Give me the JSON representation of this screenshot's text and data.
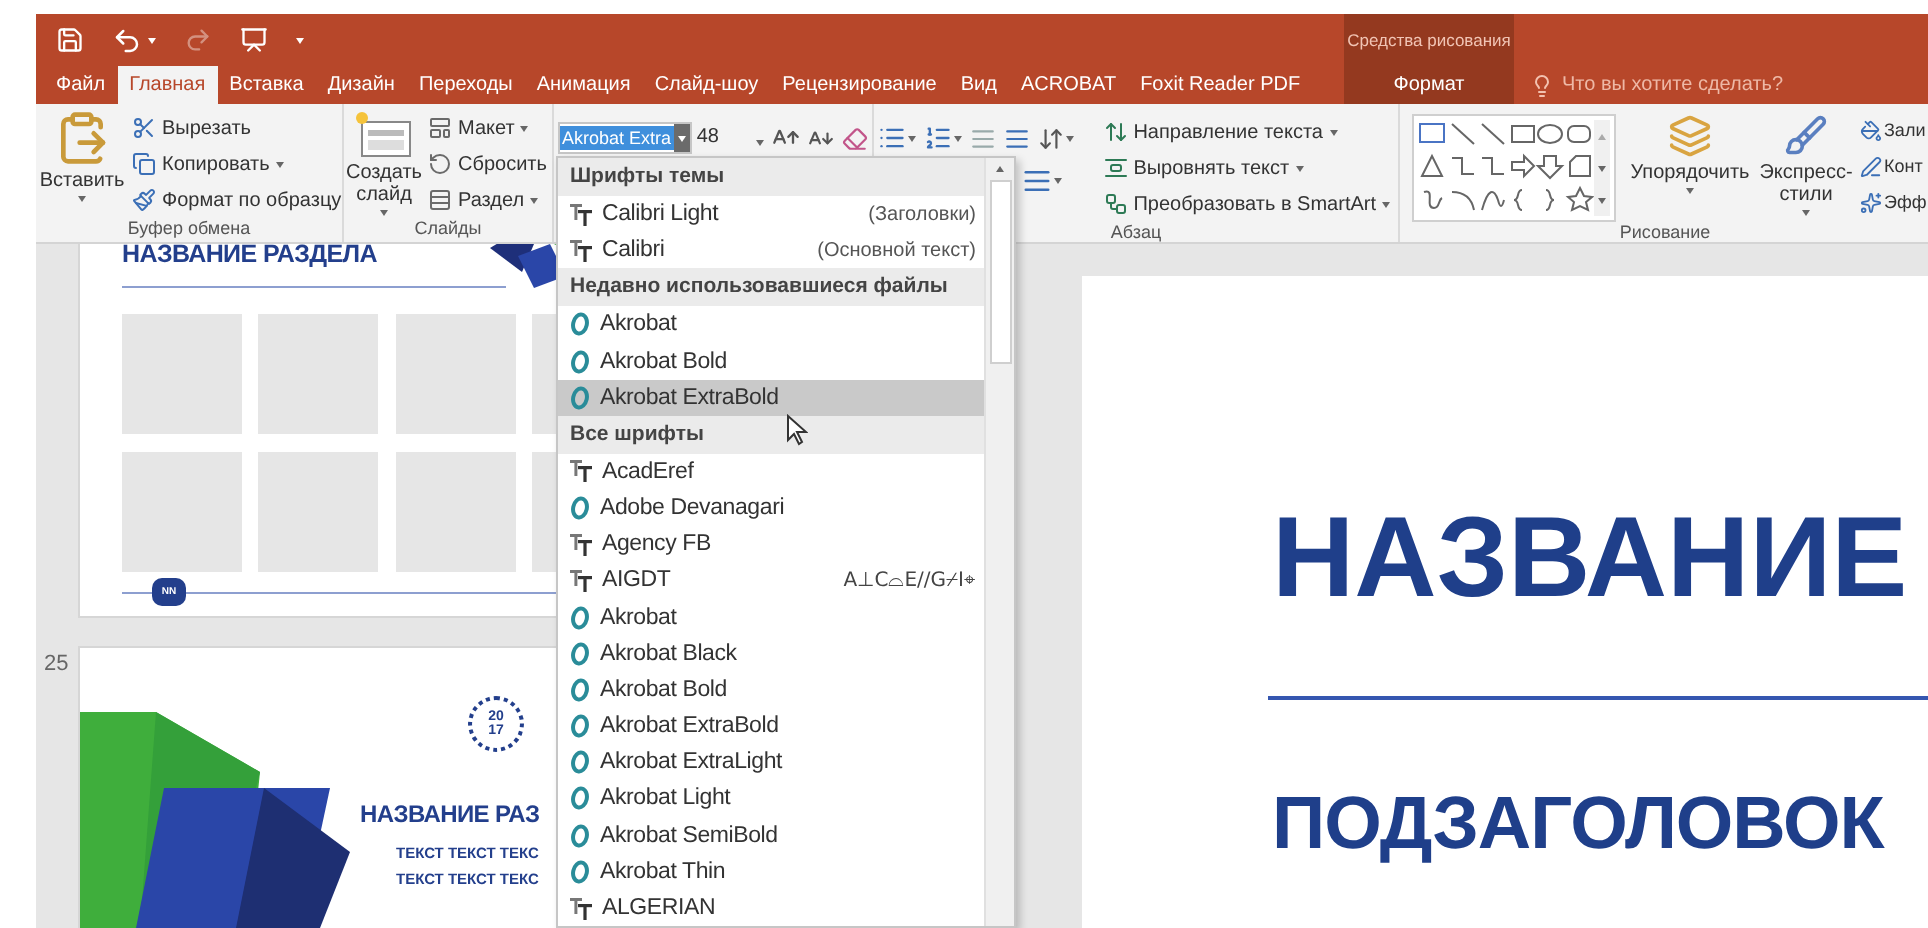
{
  "title_bar": {
    "quick_access": [
      {
        "kind": "save",
        "disabled": false
      },
      {
        "kind": "undo",
        "disabled": false
      },
      {
        "kind": "redo",
        "disabled": true
      },
      {
        "kind": "slideshow",
        "disabled": false
      },
      {
        "kind": "customize",
        "disabled": false
      }
    ],
    "context_label": "Средства рисования"
  },
  "tabs": [
    {
      "label": "Файл",
      "selected": false
    },
    {
      "label": "Главная",
      "selected": true
    },
    {
      "label": "Вставка",
      "selected": false
    },
    {
      "label": "Дизайн",
      "selected": false
    },
    {
      "label": "Переходы",
      "selected": false
    },
    {
      "label": "Анимация",
      "selected": false
    },
    {
      "label": "Слайд-шоу",
      "selected": false
    },
    {
      "label": "Рецензирование",
      "selected": false
    },
    {
      "label": "Вид",
      "selected": false
    },
    {
      "label": "ACROBAT",
      "selected": false
    },
    {
      "label": "Foxit Reader PDF",
      "selected": false
    }
  ],
  "context_tabs": [
    {
      "label": "Формат",
      "selected": false
    }
  ],
  "tell_me": {
    "placeholder": "Что вы хотите сделать?"
  },
  "ribbon": {
    "clipboard": {
      "paste": "Вставить",
      "commands": [
        {
          "label": "Вырезать",
          "dropdown": false
        },
        {
          "label": "Копировать",
          "dropdown": true
        },
        {
          "label": "Формат по образцу",
          "dropdown": false
        }
      ],
      "label": "Буфер обмена"
    },
    "slides": {
      "new_slide": "Создать слайд",
      "commands": [
        {
          "label": "Макет",
          "dropdown": true
        },
        {
          "label": "Сбросить",
          "dropdown": false
        },
        {
          "label": "Раздел",
          "dropdown": true
        }
      ],
      "label": "Слайды"
    },
    "font": {
      "font_name": "Akrobat Extra",
      "font_size": "48"
    },
    "paragraph": {
      "commands": [
        {
          "label": "Направление текста",
          "dropdown": true
        },
        {
          "label": "Выровнять текст",
          "dropdown": true
        },
        {
          "label": "Преобразовать в SmartArt",
          "dropdown": true
        }
      ],
      "label": "Абзац"
    },
    "drawing": {
      "arrange": "Упорядочить",
      "quick_styles": "Экспресс-стили",
      "commands": [
        {
          "label": "Зали",
          "kind": "fill"
        },
        {
          "label": "Конт",
          "kind": "outline"
        },
        {
          "label": "Эфф",
          "kind": "effects"
        }
      ],
      "label": "Рисование"
    }
  },
  "slide_pane": {
    "thumbnails": [
      {
        "kind": "grid",
        "title": "НАЗВАНИЕ РАЗДЕЛА",
        "badge": "NN"
      },
      {
        "kind": "section",
        "number": "25",
        "logo": [
          "20",
          "17"
        ],
        "title": "НАЗВАНИЕ РАЗ",
        "lines": [
          "ТЕКСТ ТЕКСТ ТЕКС",
          "ТЕКСТ ТЕКСТ ТЕКС"
        ]
      }
    ]
  },
  "slide": {
    "title": "НАЗВАНИЕ",
    "subtitle": "ПОДЗАГОЛОВОК"
  },
  "font_menu": {
    "groups": [
      {
        "heading": "Шрифты темы",
        "fonts": [
          {
            "name": "Calibri Light",
            "kind": "truetype",
            "note": "(Заголовки)",
            "selected": false
          },
          {
            "name": "Calibri",
            "kind": "truetype",
            "note": "(Основной текст)",
            "selected": false
          }
        ]
      },
      {
        "heading": "Недавно использовавшиеся файлы",
        "fonts": [
          {
            "name": "Akrobat",
            "kind": "opentype",
            "selected": false
          },
          {
            "name": "Akrobat Bold",
            "kind": "opentype",
            "selected": false
          },
          {
            "name": "Akrobat ExtraBold",
            "kind": "opentype",
            "selected": true
          }
        ]
      },
      {
        "heading": "Все шрифты",
        "fonts": [
          {
            "name": "AcadEref",
            "kind": "truetype",
            "selected": false
          },
          {
            "name": "Adobe Devanagari",
            "kind": "opentype",
            "selected": false
          },
          {
            "name": "Agency FB",
            "kind": "truetype",
            "selected": false
          },
          {
            "name": "AIGDT",
            "kind": "truetype",
            "sample": "A⊥C⌓E//G⌿I⌖",
            "selected": false
          },
          {
            "name": "Akrobat",
            "kind": "opentype",
            "selected": false
          },
          {
            "name": "Akrobat Black",
            "kind": "opentype",
            "selected": false
          },
          {
            "name": "Akrobat Bold",
            "kind": "opentype",
            "selected": false
          },
          {
            "name": "Akrobat ExtraBold",
            "kind": "opentype",
            "selected": false
          },
          {
            "name": "Akrobat ExtraLight",
            "kind": "opentype",
            "selected": false
          },
          {
            "name": "Akrobat Light",
            "kind": "opentype",
            "selected": false
          },
          {
            "name": "Akrobat SemiBold",
            "kind": "opentype",
            "selected": false
          },
          {
            "name": "Akrobat Thin",
            "kind": "opentype",
            "selected": false
          },
          {
            "name": "ALGERIAN",
            "kind": "truetype",
            "selected": false
          }
        ]
      }
    ]
  }
}
